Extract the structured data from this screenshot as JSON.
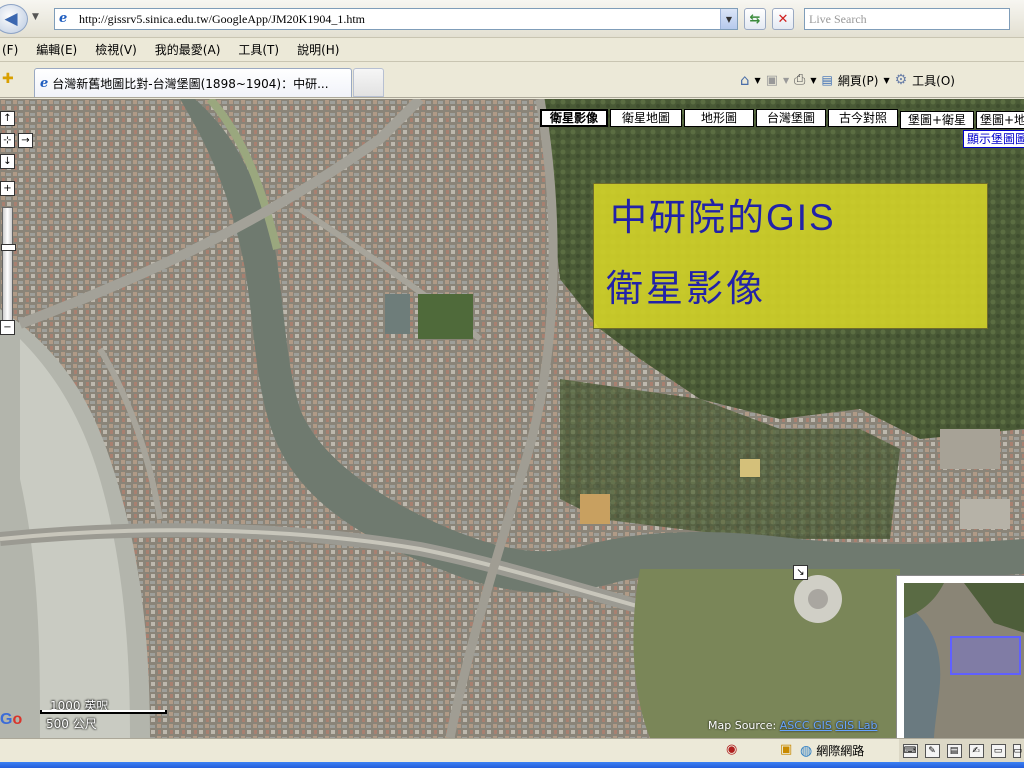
{
  "address": {
    "url": "http://gissrv5.sinica.edu.tw/GoogleApp/JM20K1904_1.htm",
    "search_placeholder": "Live Search"
  },
  "menu": [
    "(F)",
    "編輯(E)",
    "檢視(V)",
    "我的最愛(A)",
    "工具(T)",
    "說明(H)"
  ],
  "tab": {
    "title": "台灣新舊地圖比對-台灣堡圖(1898~1904)：中研..."
  },
  "commandbar": {
    "page_label": "網頁(P)",
    "tools_label": "工具(O)"
  },
  "map": {
    "types": [
      "衛星影像",
      "衛星地圖",
      "地形圖",
      "台灣堡圖",
      "古今對照",
      "堡圖+衛星",
      "堡圖+地"
    ],
    "selected_type": "衛星影像",
    "show_sheet_link": "顯示堡圖圖",
    "scale_imperial": "1000 英呎",
    "scale_metric": "500 公尺",
    "source_label": "Map Source:",
    "source_links": [
      "ASCC GIS",
      "GIS Lab"
    ]
  },
  "overlay": {
    "line1_prefix": "中研院的",
    "line1_suffix": "GIS",
    "line2": "衛星影像"
  },
  "status": {
    "zone": "網際網路"
  },
  "colors": {
    "overlay_bg": "#d6d628",
    "overlay_text": "#2222a8",
    "link": "#0000cc"
  }
}
